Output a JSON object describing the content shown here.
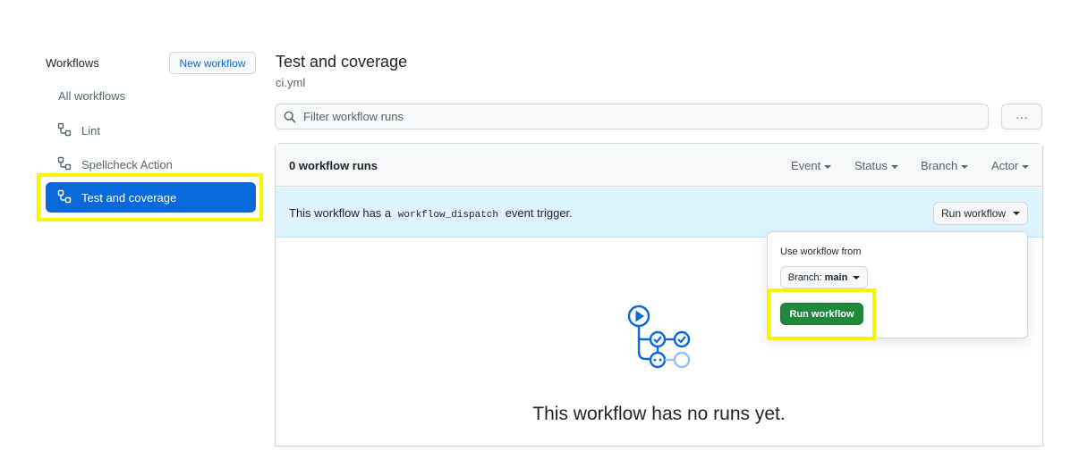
{
  "sidebar": {
    "title": "Workflows",
    "new_workflow": "New workflow",
    "all_workflows": "All workflows",
    "items": [
      {
        "label": "Lint",
        "icon": "workflow-icon"
      },
      {
        "label": "Spellcheck Action",
        "icon": "workflow-icon"
      },
      {
        "label": "Test and coverage",
        "icon": "workflow-icon",
        "active": true
      }
    ]
  },
  "main": {
    "title": "Test and coverage",
    "file": "ci.yml",
    "filter_placeholder": "Filter workflow runs",
    "kebab": "···"
  },
  "runs": {
    "count_label": "0 workflow runs",
    "filters": [
      "Event",
      "Status",
      "Branch",
      "Actor"
    ]
  },
  "notice": {
    "prefix": "This workflow has a",
    "code": "workflow_dispatch",
    "suffix": "event trigger.",
    "button": "Run workflow"
  },
  "popover": {
    "label": "Use workflow from",
    "branch_prefix": "Branch:",
    "branch_name": "main",
    "submit": "Run workflow"
  },
  "empty": {
    "title": "This workflow has no runs yet."
  },
  "colors": {
    "accent": "#0969da",
    "green": "#1f883d",
    "highlight": "#f5f500",
    "notice_bg": "#ddf4ff"
  }
}
